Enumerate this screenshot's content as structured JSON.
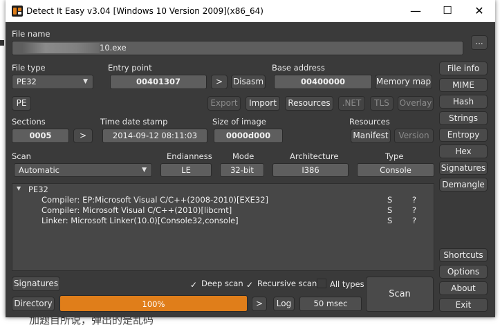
{
  "window": {
    "title": "Detect It Easy v3.04 [Windows 10 Version 2009](x86_64)",
    "minimize": "—",
    "maximize": "☐",
    "close": "✕"
  },
  "file": {
    "label": "File name",
    "value": "10.exe",
    "browse": "..."
  },
  "filetype": {
    "label": "File type",
    "value": "PE32",
    "pe_button": "PE"
  },
  "entry": {
    "label": "Entry point",
    "value": "00401307",
    "next": ">",
    "disasm": "Disasm"
  },
  "base": {
    "label": "Base address",
    "value": "00400000",
    "memory_map": "Memory map"
  },
  "toolbar": {
    "export": "Export",
    "import": "Import",
    "resources": "Resources",
    "net": ".NET",
    "tls": "TLS",
    "overlay": "Overlay"
  },
  "sections": {
    "label": "Sections",
    "value": "0005",
    "next": ">"
  },
  "timestamp": {
    "label": "Time date stamp",
    "value": "2014-09-12 08:11:03"
  },
  "image_size": {
    "label": "Size of image",
    "value": "0000d000"
  },
  "resources": {
    "label": "Resources",
    "manifest": "Manifest",
    "version": "Version"
  },
  "scan": {
    "label": "Scan",
    "value": "Automatic"
  },
  "endianness": {
    "label": "Endianness",
    "value": "LE"
  },
  "mode": {
    "label": "Mode",
    "value": "32-bit"
  },
  "architecture": {
    "label": "Architecture",
    "value": "I386"
  },
  "type": {
    "label": "Type",
    "value": "Console"
  },
  "results": {
    "root": "PE32",
    "rows": [
      {
        "text": "Compiler: EP:Microsoft Visual C/C++(2008-2010)[EXE32]",
        "s": "S",
        "q": "?"
      },
      {
        "text": "Compiler: Microsoft Visual C/C++(2010)[libcmt]",
        "s": "S",
        "q": "?"
      },
      {
        "text": "Linker: Microsoft Linker(10.0)[Console32,console]",
        "s": "S",
        "q": "?"
      }
    ]
  },
  "sidebar": {
    "file_info": "File info",
    "mime": "MIME",
    "hash": "Hash",
    "strings": "Strings",
    "entropy": "Entropy",
    "hex": "Hex",
    "signatures": "Signatures",
    "demangle": "Demangle",
    "shortcuts": "Shortcuts",
    "options": "Options",
    "about": "About",
    "exit": "Exit"
  },
  "bottom": {
    "signatures": "Signatures",
    "directory": "Directory",
    "deep_scan": "Deep scan",
    "recursive_scan": "Recursive scan",
    "all_types": "All types",
    "scan": "Scan",
    "progress_text": "100%",
    "progress": 1.0,
    "next": ">",
    "log": "Log",
    "time": "50 msec"
  },
  "background": {
    "text": "加题目所说，弹出的是乱码"
  },
  "colors": {
    "accent": "#e07e1a",
    "window_bg": "#3a3a3a"
  }
}
